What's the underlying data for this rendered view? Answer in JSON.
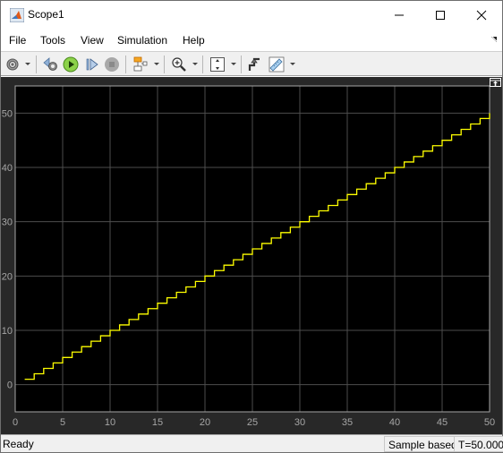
{
  "window": {
    "title": "Scope1",
    "controls": [
      "minimize",
      "maximize",
      "close"
    ]
  },
  "menu": {
    "items": [
      {
        "label": "File"
      },
      {
        "label": "Tools"
      },
      {
        "label": "View"
      },
      {
        "label": "Simulation"
      },
      {
        "label": "Help"
      }
    ]
  },
  "toolbar": {
    "buttons": [
      {
        "name": "configuration-properties",
        "icon": "gear-icon",
        "has_dropdown": true
      },
      {
        "name": "step-back",
        "icon": "step-back-icon"
      },
      {
        "name": "run",
        "icon": "play-icon"
      },
      {
        "name": "step-forward",
        "icon": "step-forward-icon"
      },
      {
        "name": "stop",
        "icon": "stop-icon",
        "disabled": true
      },
      {
        "name": "highlight-simulink-block",
        "icon": "block-highlight-icon",
        "has_dropdown": true
      },
      {
        "name": "zoom-in",
        "icon": "zoom-in-icon",
        "has_dropdown": true
      },
      {
        "name": "scale-axes",
        "icon": "scale-axes-icon",
        "has_dropdown": true
      },
      {
        "name": "triggers",
        "icon": "trigger-icon"
      },
      {
        "name": "measurements",
        "icon": "ruler-icon",
        "has_dropdown": true
      }
    ]
  },
  "status": {
    "ready": "Ready",
    "mode": "Sample based",
    "time": "T=50.000"
  },
  "colors": {
    "background": "#282828",
    "plot_bg": "#000000",
    "grid": "#4d4d4d",
    "axes": "#a6a6a6",
    "signal": "#ffff00"
  },
  "chart_data": {
    "type": "line",
    "style": "stairs",
    "title": "",
    "xlabel": "",
    "ylabel": "",
    "xlim": [
      0,
      50
    ],
    "ylim": [
      -5,
      55
    ],
    "grid": true,
    "x_ticks": [
      0,
      5,
      10,
      15,
      20,
      25,
      30,
      35,
      40,
      45,
      50
    ],
    "y_ticks": [
      0,
      10,
      20,
      30,
      40,
      50
    ],
    "series": [
      {
        "name": "signal",
        "color": "#ffff00",
        "x": [
          1,
          2,
          3,
          4,
          5,
          6,
          7,
          8,
          9,
          10,
          11,
          12,
          13,
          14,
          15,
          16,
          17,
          18,
          19,
          20,
          21,
          22,
          23,
          24,
          25,
          26,
          27,
          28,
          29,
          30,
          31,
          32,
          33,
          34,
          35,
          36,
          37,
          38,
          39,
          40,
          41,
          42,
          43,
          44,
          45,
          46,
          47,
          48,
          49,
          50
        ],
        "y": [
          1,
          2,
          3,
          4,
          5,
          6,
          7,
          8,
          9,
          10,
          11,
          12,
          13,
          14,
          15,
          16,
          17,
          18,
          19,
          20,
          21,
          22,
          23,
          24,
          25,
          26,
          27,
          28,
          29,
          30,
          31,
          32,
          33,
          34,
          35,
          36,
          37,
          38,
          39,
          40,
          41,
          42,
          43,
          44,
          45,
          46,
          47,
          48,
          49,
          50
        ]
      }
    ]
  }
}
